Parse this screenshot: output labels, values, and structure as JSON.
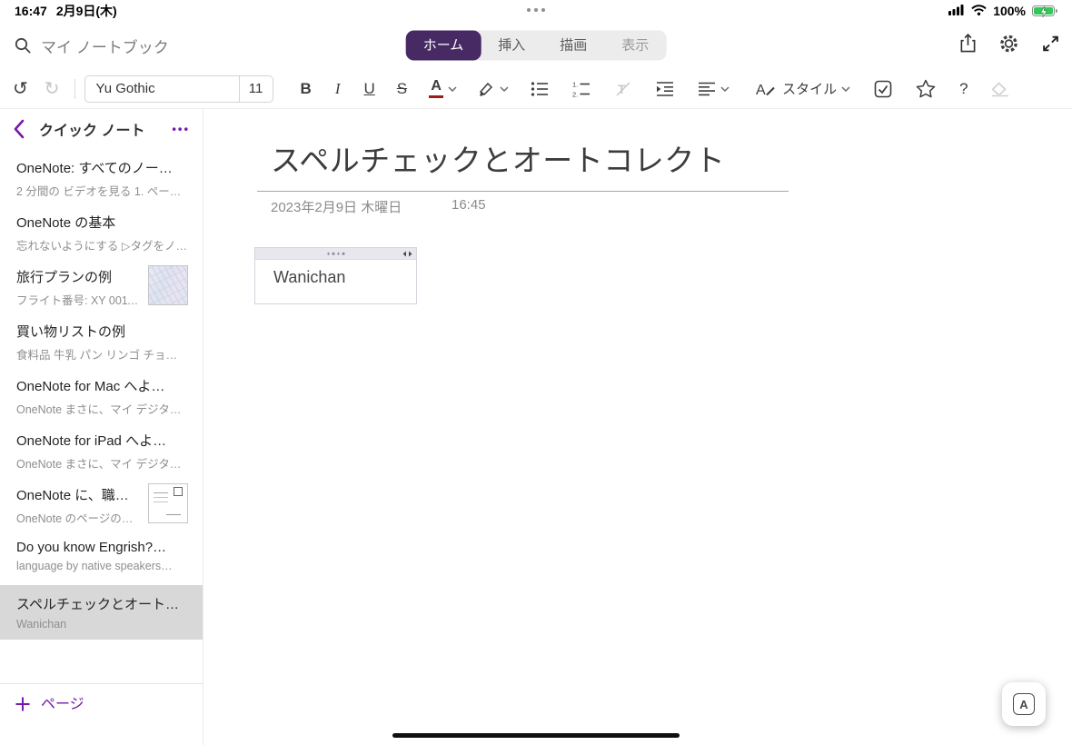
{
  "colors": {
    "accent": "#7719AA",
    "tab_selected_bg": "#472a63",
    "selected_item_bg": "#d8d8d8"
  },
  "status_bar": {
    "time": "16:47",
    "date": "2月9日(木)",
    "battery_percent": "100%"
  },
  "top_bar": {
    "notebook_label": "マイ ノートブック",
    "tabs": [
      {
        "label": "ホーム",
        "selected": true
      },
      {
        "label": "挿入",
        "selected": false
      },
      {
        "label": "描画",
        "selected": false
      },
      {
        "label": "表示",
        "selected": false
      }
    ]
  },
  "format_bar": {
    "undo": "↺",
    "redo": "↻",
    "font_name": "Yu Gothic",
    "font_size": "11",
    "bold": "B",
    "italic": "I",
    "underline": "U",
    "strikethrough": "S",
    "font_color_letter": "A",
    "style_label": "スタイル",
    "help": "?"
  },
  "sidebar": {
    "section_title": "クイック ノート",
    "menu_dots": "•••",
    "items": [
      {
        "title": "OneNote: すべてのノー…",
        "subtitle": "2 分間の ビデオを見る 1. ペー…"
      },
      {
        "title": "OneNote の基本",
        "subtitle": "忘れないようにする ▷タグをノ…"
      },
      {
        "title": "旅行プランの例",
        "subtitle": "フライト番号: XY 0011…"
      },
      {
        "title": "買い物リストの例",
        "subtitle": "食料品 牛乳 パン リンゴ チョ…"
      },
      {
        "title": "OneNote for Mac へよ…",
        "subtitle": "OneNote まさに、マイ デジタ…"
      },
      {
        "title": "OneNote for iPad へよ…",
        "subtitle": "OneNote まさに、マイ デジタ…"
      },
      {
        "title": "OneNote に、職…",
        "subtitle": "OneNote のページの…"
      },
      {
        "title": "Do you know Engrish?…",
        "subtitle": "language by native speakers…"
      },
      {
        "title": "スペルチェックとオート…",
        "subtitle": "Wanichan"
      }
    ],
    "add_page_label": "ページ"
  },
  "page": {
    "title": "スペルチェックとオートコレクト",
    "date": "2023年2月9日 木曜日",
    "time": "16:45",
    "block_text": "Wanichan"
  },
  "floating_button": {
    "label": "A"
  }
}
